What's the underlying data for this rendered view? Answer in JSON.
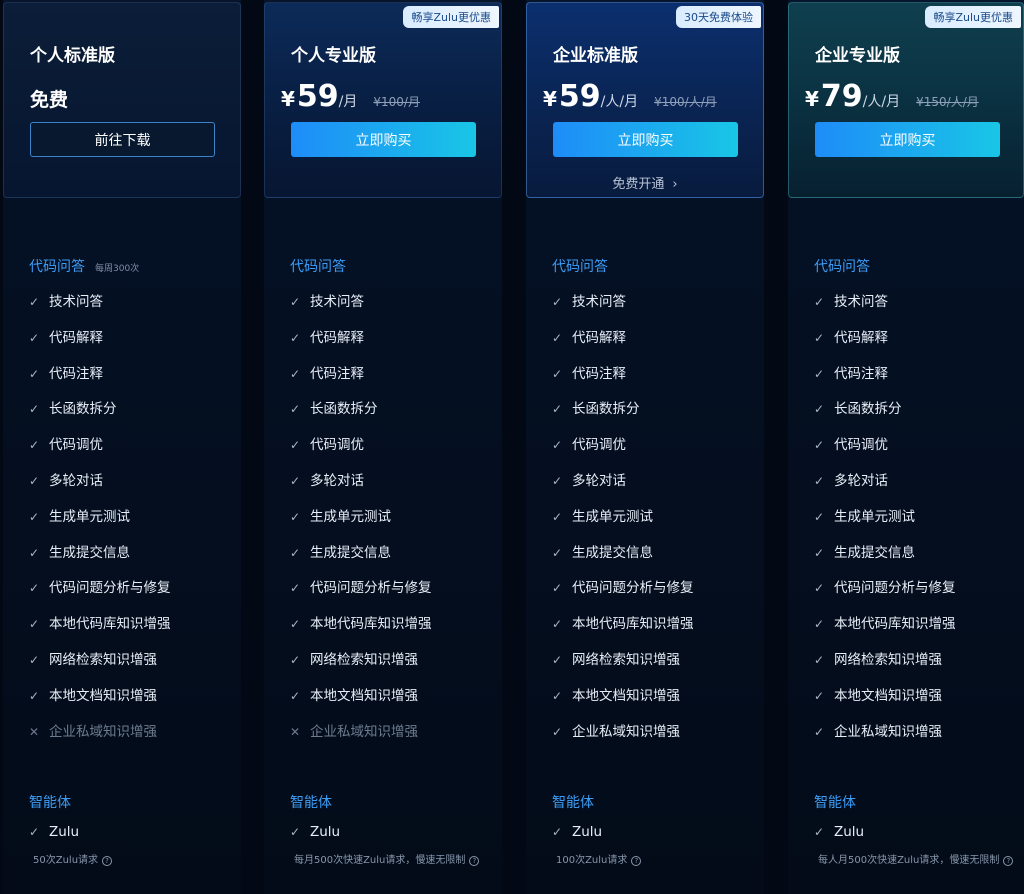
{
  "plans": [
    {
      "title": "个人标准版",
      "free_label": "免费",
      "button": "前往下载",
      "features_section": "代码问答",
      "features_note": "每周300次",
      "agent_section": "智能体",
      "agent_item": "Zulu",
      "quota": "50次Zulu请求",
      "disabled_feature": "企业私域知识增强"
    },
    {
      "badge": "畅享Zulu更优惠",
      "title": "个人专业版",
      "currency": "¥",
      "price": "59",
      "unit": "/月",
      "original_price": "¥100/月",
      "button": "立即购买",
      "features_section": "代码问答",
      "agent_section": "智能体",
      "agent_item": "Zulu",
      "quota": "每月500次快速Zulu请求，慢速无限制",
      "disabled_feature": "企业私域知识增强"
    },
    {
      "badge": "30天免费体验",
      "title": "企业标准版",
      "currency": "¥",
      "price": "59",
      "unit": "/人/月",
      "original_price": "¥100/人/月",
      "button": "立即购买",
      "trial_link": "免费开通",
      "features_section": "代码问答",
      "agent_section": "智能体",
      "agent_item": "Zulu",
      "quota": "100次Zulu请求",
      "last_feature": "企业私域知识增强"
    },
    {
      "badge": "畅享Zulu更优惠",
      "title": "企业专业版",
      "currency": "¥",
      "price": "79",
      "unit": "/人/月",
      "original_price": "¥150/人/月",
      "button": "立即购买",
      "features_section": "代码问答",
      "agent_section": "智能体",
      "agent_item": "Zulu",
      "quota": "每人月500次快速Zulu请求，慢速无限制",
      "last_feature": "企业私域知识增强"
    }
  ],
  "features": [
    "技术问答",
    "代码解释",
    "代码注释",
    "长函数拆分",
    "代码调优",
    "多轮对话",
    "生成单元测试",
    "生成提交信息",
    "代码问题分析与修复",
    "本地代码库知识增强",
    "网络检索知识增强",
    "本地文档知识增强"
  ],
  "icons": {
    "check": "check-icon",
    "cross": "cross-icon",
    "chevron": "chevron-right-icon",
    "help": "question-circle-icon"
  },
  "colors": {
    "accent": "#3c9df7",
    "button_start": "#1e8cf8",
    "button_end": "#19c6e6",
    "background": "#020814"
  }
}
